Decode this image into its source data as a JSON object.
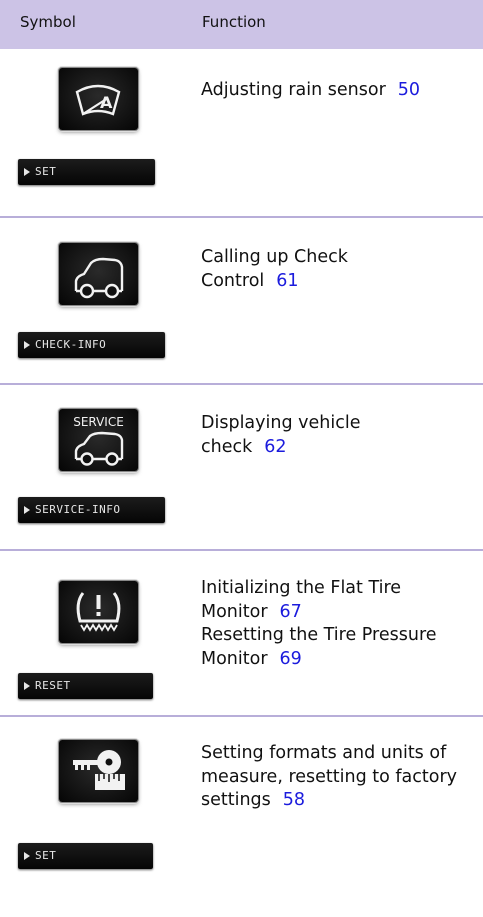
{
  "header": {
    "symbol": "Symbol",
    "function": "Function"
  },
  "rows": [
    {
      "icon": "rain-sensor-icon",
      "button_label": "SET",
      "function_text": "Adjusting rain sensor",
      "page_ref": "50"
    },
    {
      "icon": "check-control-car-icon",
      "button_label": "CHECK-INFO",
      "function_text": "Calling up Check Control",
      "page_ref": "61"
    },
    {
      "icon": "service-car-icon",
      "icon_text": "SERVICE",
      "button_label": "SERVICE-INFO",
      "function_text": "Displaying vehicle check",
      "page_ref": "62"
    },
    {
      "icon": "tire-pressure-warning-icon",
      "button_label": "RESET",
      "function_text_1": "Initializing the Flat Tire Monitor",
      "page_ref_1": "67",
      "function_text_2": "Resetting the Tire Pressure Monitor",
      "page_ref_2": "69"
    },
    {
      "icon": "key-ruler-settings-icon",
      "button_label": "SET",
      "function_text": "Setting formats and units of measure, resetting to factory settings",
      "page_ref": "58"
    }
  ]
}
